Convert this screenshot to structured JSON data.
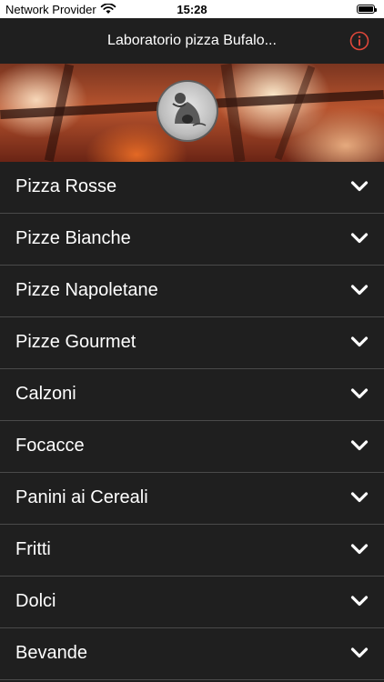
{
  "status_bar": {
    "carrier": "Network Provider",
    "time": "15:28"
  },
  "nav": {
    "title": "Laboratorio pizza Bufalo...",
    "info_icon": "info-circle-icon",
    "info_color": "#e0473a"
  },
  "hero": {
    "logo_icon": "pizzeria-logo"
  },
  "menu": {
    "items": [
      {
        "label": "Pizza Rosse"
      },
      {
        "label": "Pizze Bianche"
      },
      {
        "label": "Pizze Napoletane"
      },
      {
        "label": "Pizze Gourmet"
      },
      {
        "label": "Calzoni"
      },
      {
        "label": "Focacce"
      },
      {
        "label": "Panini ai Cereali"
      },
      {
        "label": "Fritti"
      },
      {
        "label": "Dolci"
      },
      {
        "label": "Bevande"
      }
    ],
    "chevron_icon": "chevron-down-icon"
  }
}
